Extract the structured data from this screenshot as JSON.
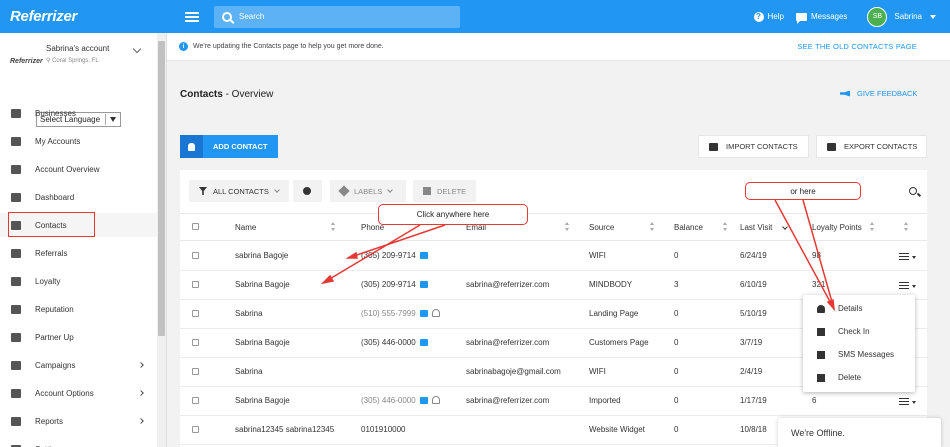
{
  "app": {
    "brand": "Referrizer",
    "accent": "#2196f3"
  },
  "topbar": {
    "search_placeholder": "Search",
    "help_label": "Help",
    "messages_label": "Messages",
    "user_initials": "SB",
    "user_name": "Sabrina"
  },
  "sidebar": {
    "account_name": "Sabrina's account",
    "account_location": "Coral Springs, FL",
    "account_logo_text": "Referrizer",
    "language_select": "Select Language",
    "items": [
      {
        "label": "Businesses",
        "icon": "briefcase-icon",
        "has_chevron": false
      },
      {
        "label": "My Accounts",
        "icon": "layers-icon",
        "has_chevron": false
      },
      {
        "label": "Account Overview",
        "icon": "gauge-icon",
        "has_chevron": false
      },
      {
        "label": "Dashboard",
        "icon": "bar-chart-icon",
        "has_chevron": false
      },
      {
        "label": "Contacts",
        "icon": "contacts-icon",
        "has_chevron": false
      },
      {
        "label": "Referrals",
        "icon": "referrals-icon",
        "has_chevron": false
      },
      {
        "label": "Loyalty",
        "icon": "refresh-icon",
        "has_chevron": false
      },
      {
        "label": "Reputation",
        "icon": "star-icon",
        "has_chevron": false
      },
      {
        "label": "Partner Up",
        "icon": "handshake-icon",
        "has_chevron": false
      },
      {
        "label": "Campaigns",
        "icon": "megaphone-icon",
        "has_chevron": true
      },
      {
        "label": "Account Options",
        "icon": "list-icon",
        "has_chevron": true
      },
      {
        "label": "Reports",
        "icon": "report-icon",
        "has_chevron": true
      },
      {
        "label": "Settings",
        "icon": "gear-icon",
        "has_chevron": false
      }
    ]
  },
  "banner": {
    "message": "We're updating the Contacts page to help you get more done.",
    "link": "SEE THE OLD CONTACTS PAGE"
  },
  "page": {
    "title_bold": "Contacts",
    "title_rest": " - Overview",
    "feedback": "GIVE FEEDBACK",
    "add_contact": "ADD CONTACT",
    "import_contacts": "IMPORT CONTACTS",
    "export_contacts": "EXPORT CONTACTS"
  },
  "toolbar": {
    "filter": "ALL CONTACTS",
    "labels": "LABELS",
    "delete": "DELETE"
  },
  "table": {
    "headers": {
      "name": "Name",
      "phone": "Phone",
      "email": "Email",
      "source": "Source",
      "balance": "Balance",
      "last_visit": "Last Visit",
      "loyalty": "Loyalty Points"
    },
    "rows": [
      {
        "name": "sabrina Bagoje",
        "phone": "(305) 209-9714",
        "phone_gray": false,
        "chat": true,
        "user": false,
        "email": "",
        "source": "WIFI",
        "balance": "0",
        "last_visit": "6/24/19",
        "loyalty": "98",
        "menu": true
      },
      {
        "name": "Sabrina Bagoje",
        "phone": "(305) 209-9714",
        "phone_gray": false,
        "chat": true,
        "user": false,
        "email": "sabrina@referrizer.com",
        "source": "MINDBODY",
        "balance": "3",
        "last_visit": "6/10/19",
        "loyalty": "321",
        "menu": true
      },
      {
        "name": "Sabrina",
        "phone": "(510) 555-7999",
        "phone_gray": true,
        "chat": true,
        "user": true,
        "email": "",
        "source": "Landing Page",
        "balance": "0",
        "last_visit": "5/10/19",
        "loyalty": "",
        "menu": false
      },
      {
        "name": "Sabrina Bagoje",
        "phone": "(305) 446-0000",
        "phone_gray": false,
        "chat": true,
        "user": false,
        "email": "sabrina@referrizer.com",
        "source": "Customers Page",
        "balance": "0",
        "last_visit": "3/7/19",
        "loyalty": "",
        "menu": false
      },
      {
        "name": "Sabrina",
        "phone": "",
        "phone_gray": false,
        "chat": false,
        "user": false,
        "email": "sabrinabagoje@gmail.com",
        "source": "WIFI",
        "balance": "0",
        "last_visit": "2/4/19",
        "loyalty": "",
        "menu": false
      },
      {
        "name": "Sabrina Bagoje",
        "phone": "(305) 446-0000",
        "phone_gray": true,
        "chat": true,
        "user": true,
        "email": "sabrina@referrizer.com",
        "source": "Imported",
        "balance": "0",
        "last_visit": "1/17/19",
        "loyalty": "6",
        "menu": true
      },
      {
        "name": "sabrina12345 sabrina12345",
        "phone": "0101910000",
        "phone_gray": false,
        "chat": false,
        "user": false,
        "email": "",
        "source": "Website Widget",
        "balance": "0",
        "last_visit": "10/8/18",
        "loyalty": "",
        "menu": false
      }
    ]
  },
  "row_menu": {
    "items": [
      {
        "label": "Details",
        "icon": "person-icon"
      },
      {
        "label": "Check In",
        "icon": "check-in-icon"
      },
      {
        "label": "SMS Messages",
        "icon": "chat-icon"
      },
      {
        "label": "Delete",
        "icon": "trash-icon"
      }
    ]
  },
  "annotations": {
    "click_anywhere": "Click anywhere here",
    "or_here": "or here"
  },
  "chat_widget": {
    "status": "We're Offline."
  }
}
